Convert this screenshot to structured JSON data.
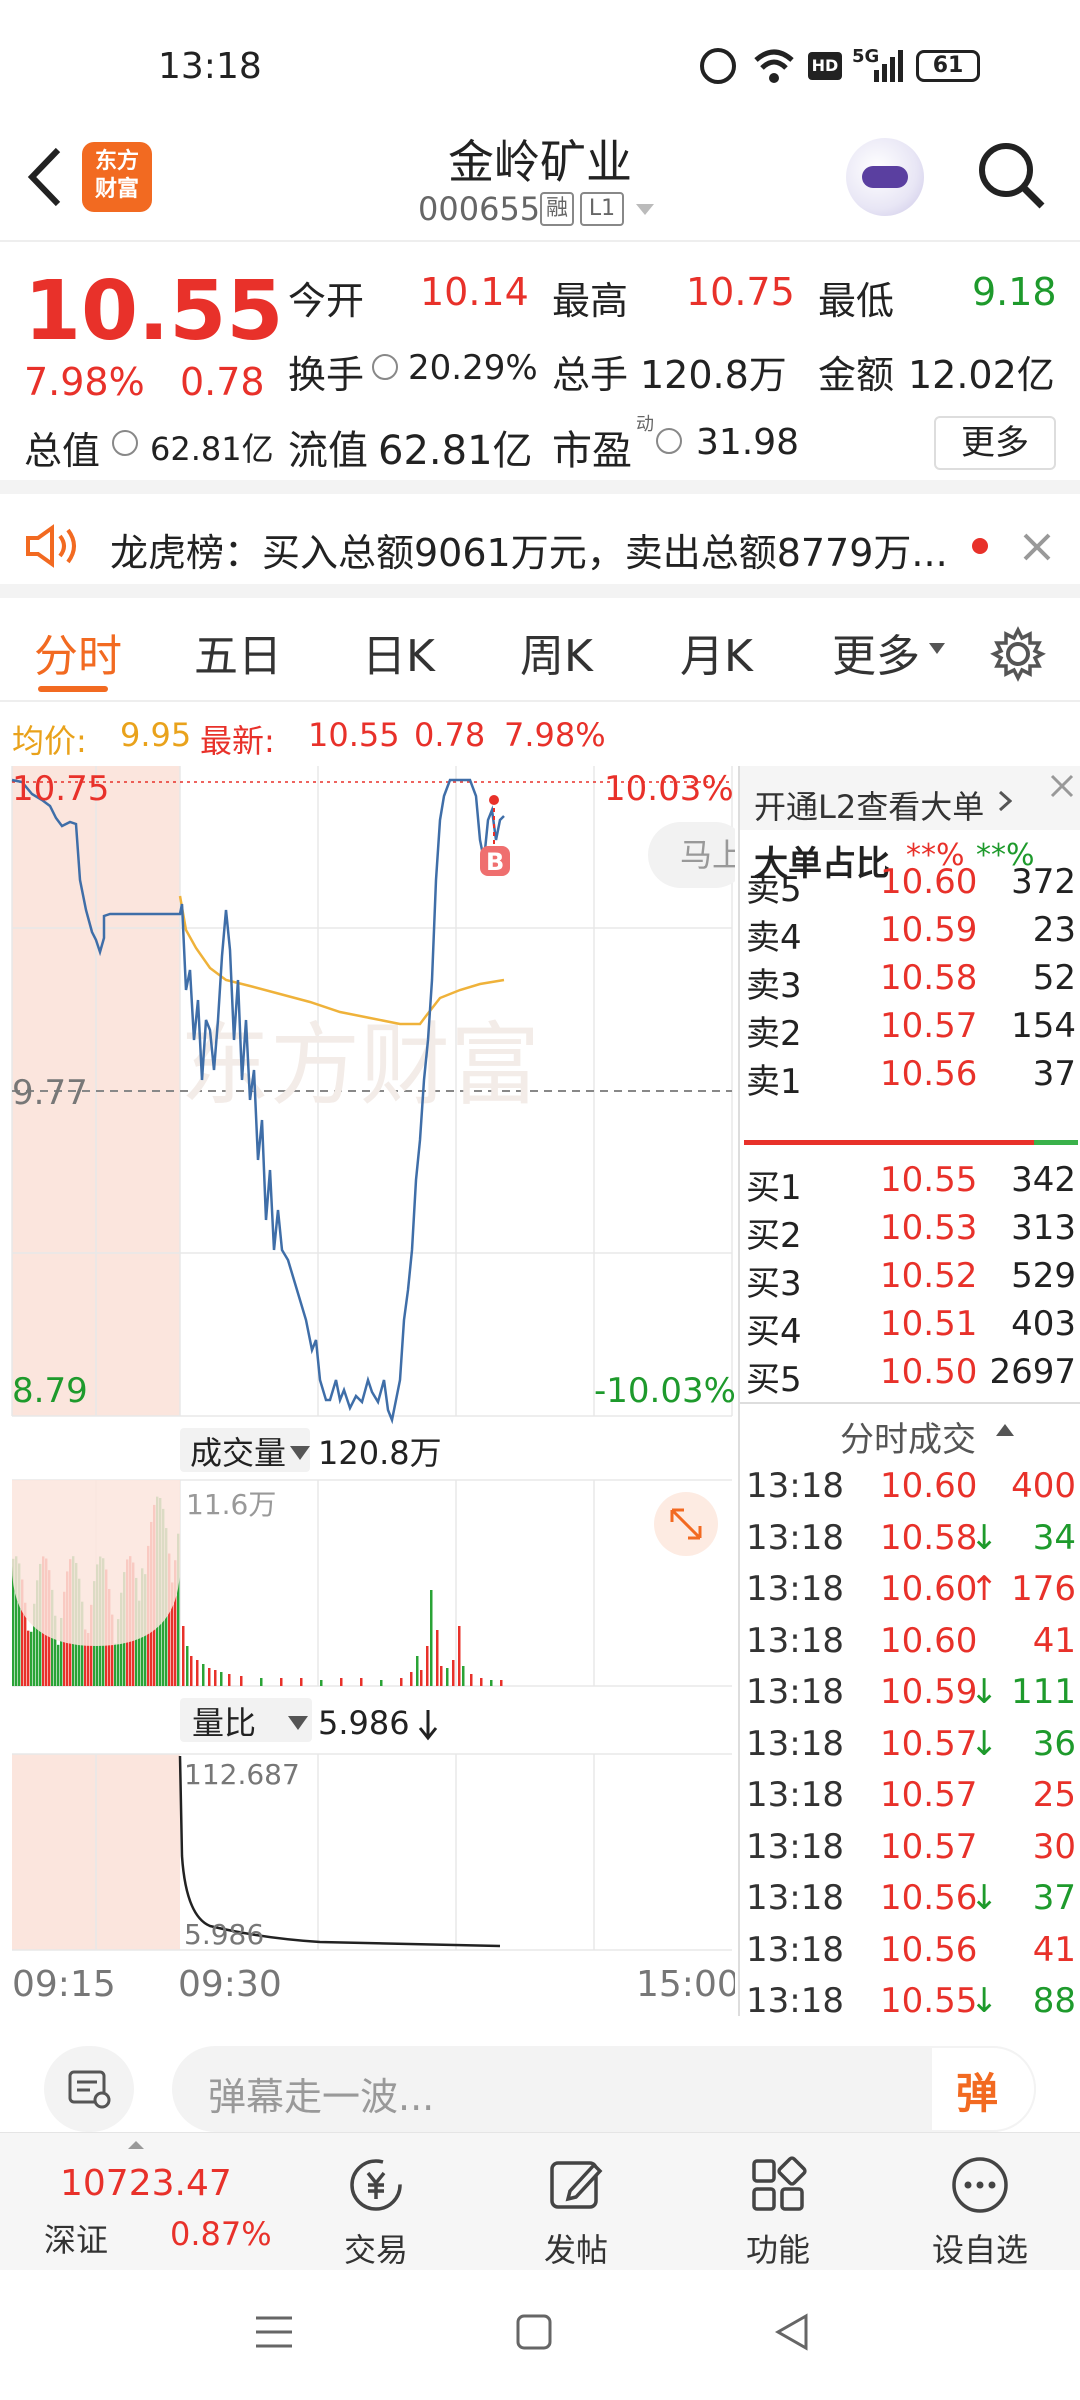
{
  "status": {
    "time": "13:18",
    "battery": "61",
    "net": "5G",
    "hd": "HD"
  },
  "header": {
    "logo_line1": "东方",
    "logo_line2": "财富",
    "title": "金岭矿业",
    "code": "000655",
    "badge_rong": "融",
    "badge_l1": "L1"
  },
  "quote": {
    "price": "10.55",
    "change_pct": "7.98%",
    "change": "0.78",
    "open_label": "今开",
    "open": "10.14",
    "high_label": "最高",
    "high": "10.75",
    "low_label": "最低",
    "low": "9.18",
    "turnover_label": "换手",
    "turnover": "20.29%",
    "vol_label": "总手",
    "vol": "120.8万",
    "amount_label": "金额",
    "amount": "12.02亿",
    "mktcap_label": "总值",
    "mktcap": "62.81亿",
    "float_label": "流值",
    "float": "62.81亿",
    "pe_label": "市盈",
    "pe_sup": "动",
    "pe": "31.98",
    "more_btn": "更多"
  },
  "notice": {
    "text": "龙虎榜：买入总额9061万元，卖出总额8779万..."
  },
  "tabs": [
    "分时",
    "五日",
    "日K",
    "周K",
    "月K",
    "更多"
  ],
  "avgline": {
    "avg_label": "均价:",
    "avg": "9.95",
    "latest_label": "最新:",
    "latest": "10.55",
    "chg": "0.78",
    "pct": "7.98%"
  },
  "chart": {
    "top_price": "10.75",
    "top_pct": "10.03%",
    "mid_price": "9.77",
    "bottom_price": "8.79",
    "bottom_pct": "-10.03%",
    "marker": "B",
    "popup_text": "马上",
    "vol_label": "成交量",
    "vol_value": "120.8万",
    "vol_max": "11.6万",
    "ratio_label": "量比",
    "ratio_value": "5.986",
    "ratio_max": "112.687",
    "ratio_min": "5.986",
    "time_start": "09:15",
    "time_open": "09:30",
    "time_end": "15:00"
  },
  "orderbook": {
    "l2_text": "开通L2查看大单",
    "big_label": "大单占比",
    "big_buy": "**%",
    "big_sell": "**%",
    "sells": [
      {
        "label": "卖5",
        "price": "10.60",
        "vol": "372"
      },
      {
        "label": "卖4",
        "price": "10.59",
        "vol": "23"
      },
      {
        "label": "卖3",
        "price": "10.58",
        "vol": "52"
      },
      {
        "label": "卖2",
        "price": "10.57",
        "vol": "154"
      },
      {
        "label": "卖1",
        "price": "10.56",
        "vol": "37"
      }
    ],
    "buys": [
      {
        "label": "买1",
        "price": "10.55",
        "vol": "342"
      },
      {
        "label": "买2",
        "price": "10.53",
        "vol": "313"
      },
      {
        "label": "买3",
        "price": "10.52",
        "vol": "529"
      },
      {
        "label": "买4",
        "price": "10.51",
        "vol": "403"
      },
      {
        "label": "买5",
        "price": "10.50",
        "vol": "2697"
      }
    ],
    "trades_title": "分时成交",
    "trades": [
      {
        "time": "13:18",
        "price": "10.60",
        "arrow": "",
        "vol": "400",
        "side": "buy"
      },
      {
        "time": "13:18",
        "price": "10.58",
        "arrow": "↓",
        "vol": "34",
        "side": "sell"
      },
      {
        "time": "13:18",
        "price": "10.60",
        "arrow": "↑",
        "vol": "176",
        "side": "buy"
      },
      {
        "time": "13:18",
        "price": "10.60",
        "arrow": "",
        "vol": "41",
        "side": "buy"
      },
      {
        "time": "13:18",
        "price": "10.59",
        "arrow": "↓",
        "vol": "111",
        "side": "sell"
      },
      {
        "time": "13:18",
        "price": "10.57",
        "arrow": "↓",
        "vol": "36",
        "side": "sell"
      },
      {
        "time": "13:18",
        "price": "10.57",
        "arrow": "",
        "vol": "25",
        "side": "buy"
      },
      {
        "time": "13:18",
        "price": "10.57",
        "arrow": "",
        "vol": "30",
        "side": "buy"
      },
      {
        "time": "13:18",
        "price": "10.56",
        "arrow": "↓",
        "vol": "37",
        "side": "sell"
      },
      {
        "time": "13:18",
        "price": "10.56",
        "arrow": "",
        "vol": "41",
        "side": "buy"
      },
      {
        "time": "13:18",
        "price": "10.55",
        "arrow": "↓",
        "vol": "88",
        "side": "sell"
      }
    ]
  },
  "comment": {
    "placeholder": "弹幕走一波...",
    "danmu_btn": "弹"
  },
  "bottomnav": {
    "index_value": "10723.47",
    "index_name": "深证",
    "index_pct": "0.87%",
    "items": [
      {
        "label": "交易"
      },
      {
        "label": "发帖"
      },
      {
        "label": "功能"
      },
      {
        "label": "设自选"
      }
    ]
  }
}
